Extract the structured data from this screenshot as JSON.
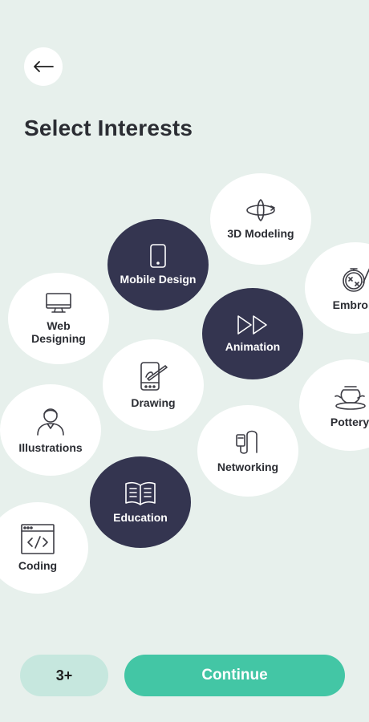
{
  "header": {
    "back_icon": "arrow-left-icon",
    "title": "Select Interests"
  },
  "interests": {
    "modeling": {
      "label": "3D Modeling",
      "icon": "rotate-3d-icon",
      "selected": false
    },
    "mobile_design": {
      "label": "Mobile Design",
      "icon": "smartphone-icon",
      "selected": true
    },
    "embroidery": {
      "label": "Embroid",
      "icon": "embroidery-hoop-icon",
      "selected": false
    },
    "web_designing": {
      "label": "Web Designing",
      "icon": "monitor-icon",
      "selected": false
    },
    "animation": {
      "label": "Animation",
      "icon": "fast-forward-icon",
      "selected": true
    },
    "drawing": {
      "label": "Drawing",
      "icon": "tablet-pen-icon",
      "selected": false
    },
    "pottery": {
      "label": "Pottery",
      "icon": "pottery-wheel-icon",
      "selected": false
    },
    "illustrations": {
      "label": "Illustrations",
      "icon": "person-icon",
      "selected": false
    },
    "networking": {
      "label": "Networking",
      "icon": "network-cable-icon",
      "selected": false
    },
    "education": {
      "label": "Education",
      "icon": "open-book-icon",
      "selected": true
    },
    "coding": {
      "label": "Coding",
      "icon": "code-window-icon",
      "selected": false
    }
  },
  "footer": {
    "count_label": "3+",
    "continue_label": "Continue"
  },
  "colors": {
    "background": "#e7f0ec",
    "bubble": "#ffffff",
    "bubble_selected": "#343550",
    "primary": "#43c6a5",
    "count_bg": "#c6e7de",
    "text_dark": "#2b2d33"
  }
}
